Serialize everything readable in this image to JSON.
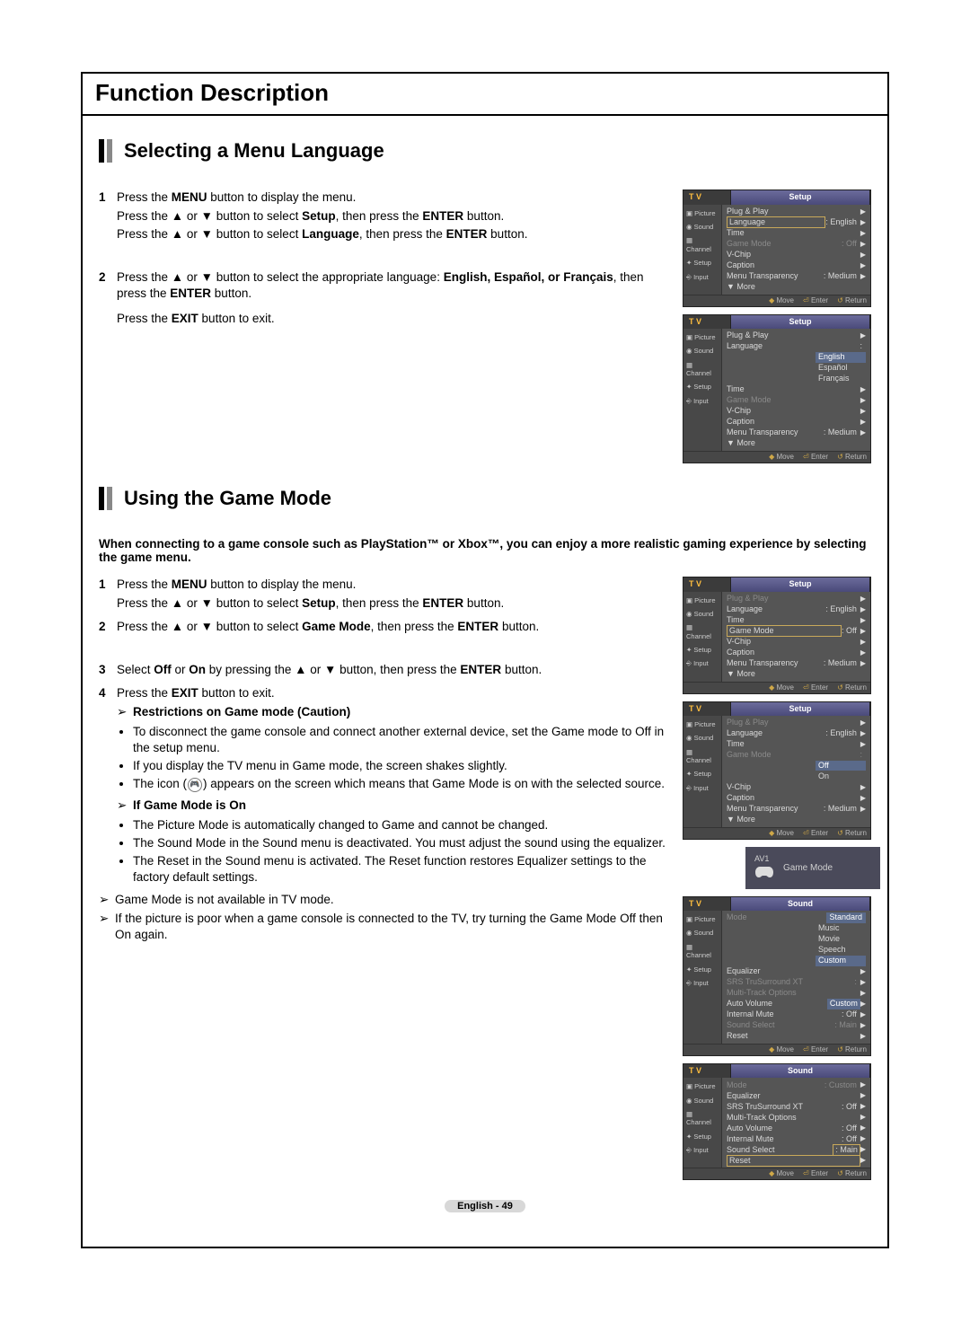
{
  "title": "Function Description",
  "section1": {
    "heading": "Selecting a Menu Language",
    "steps": [
      {
        "num": "1",
        "lines": [
          {
            "pre": "Press the ",
            "b1": "MENU",
            "post": " button to display the menu."
          },
          {
            "pre": "Press the ▲ or ▼ button to select ",
            "b1": "Setup",
            "mid": ", then press the ",
            "b2": "ENTER",
            "post": " button."
          },
          {
            "pre": "Press the ▲ or ▼ button to select ",
            "b1": "Language",
            "mid": ", then press the ",
            "b2": "ENTER",
            "post": " button."
          }
        ]
      },
      {
        "num": "2",
        "lines": [
          {
            "text": "Press the ▲ or ▼ button to select the appropriate language: ",
            "langs": "English, Español, or Français",
            "mid": ", then press the ",
            "b1": "ENTER",
            "post": " button."
          },
          {
            "pre": "Press the ",
            "b1": "EXIT",
            "post": " button to exit."
          }
        ]
      }
    ]
  },
  "section2": {
    "heading": "Using the Game Mode",
    "intro": "When connecting to a game console such as PlayStation™ or Xbox™, you can enjoy a more realistic gaming experience by selecting the game menu.",
    "steps": [
      {
        "num": "1",
        "lines": [
          {
            "pre": "Press the ",
            "b1": "MENU",
            "post": " button to display the menu."
          },
          {
            "pre": "Press the ▲ or ▼ button to select ",
            "b1": "Setup",
            "mid": ", then press the ",
            "b2": "ENTER",
            "post": " button."
          }
        ]
      },
      {
        "num": "2",
        "lines": [
          {
            "pre": "Press the ▲ or ▼ button to select ",
            "b1": "Game Mode",
            "mid": ", then press the ",
            "b2": "ENTER",
            "post": " button."
          }
        ]
      },
      {
        "num": "3",
        "lines": [
          {
            "pre": "Select ",
            "b1": "Off",
            "mid": " or ",
            "b2": "On",
            "mid2": " by pressing the ▲ or ▼ button, then press the ",
            "b3": "ENTER",
            "post": " button."
          }
        ]
      },
      {
        "num": "4",
        "lines": [
          {
            "pre": "Press the ",
            "b1": "EXIT",
            "post": " button to exit."
          }
        ]
      }
    ],
    "restrictions_head": "Restrictions on Game mode (Caution)",
    "restrictions": [
      "To disconnect the game console and connect another external device, set the Game mode to Off in the setup menu.",
      "If you display the TV menu in Game mode, the screen shakes slightly.",
      "The icon ( 🎮 ) appears on the screen which means that Game Mode is on with the selected source."
    ],
    "ifon_head": "If Game Mode is On",
    "ifon": [
      "The Picture Mode is automatically changed to Game and cannot be changed.",
      "The Sound Mode in the Sound menu is deactivated. You must adjust the sound using the equalizer.",
      "The Reset in the Sound menu is activated. The Reset function restores Equalizer settings to the factory default settings."
    ],
    "notes": [
      "Game Mode is not available in TV mode.",
      "If the picture is poor when a game console is connected to the TV, try turning the Game Mode Off then On again."
    ]
  },
  "osd_side": [
    "Picture",
    "Sound",
    "Channel",
    "Setup",
    "Input"
  ],
  "osd1": {
    "tab": "Setup",
    "tv": "T V",
    "rows": [
      {
        "label": "Plug & Play"
      },
      {
        "label": "Language",
        "val": ": English",
        "boxed": true
      },
      {
        "label": "Time"
      },
      {
        "label": "Game Mode",
        "val": ": Off",
        "dim": true
      },
      {
        "label": "V-Chip"
      },
      {
        "label": "Caption"
      },
      {
        "label": "Menu Transparency",
        "val": ": Medium"
      },
      {
        "label": "▼ More",
        "more": true
      }
    ]
  },
  "osd2": {
    "tab": "Setup",
    "tv": "T V",
    "rows": [
      {
        "label": "Plug & Play"
      },
      {
        "label": "Language",
        "opts": [
          "English",
          "Español",
          "Français"
        ]
      },
      {
        "label": "Time"
      },
      {
        "label": "Game Mode",
        "dim": true
      },
      {
        "label": "V-Chip"
      },
      {
        "label": "Caption"
      },
      {
        "label": "Menu Transparency",
        "val": ": Medium"
      },
      {
        "label": "▼ More",
        "more": true
      }
    ]
  },
  "osd3": {
    "tab": "Setup",
    "tv": "T V",
    "rows": [
      {
        "label": "Plug & Play",
        "dim": true
      },
      {
        "label": "Language",
        "val": ": English"
      },
      {
        "label": "Time"
      },
      {
        "label": "Game Mode",
        "val": ": Off",
        "boxed": true
      },
      {
        "label": "V-Chip"
      },
      {
        "label": "Caption"
      },
      {
        "label": "Menu Transparency",
        "val": ": Medium"
      },
      {
        "label": "▼ More",
        "more": true
      }
    ]
  },
  "osd4": {
    "tab": "Setup",
    "tv": "T V",
    "rows": [
      {
        "label": "Plug & Play",
        "dim": true
      },
      {
        "label": "Language",
        "val": ": English"
      },
      {
        "label": "Time"
      },
      {
        "label": "Game Mode",
        "opts": [
          "Off",
          "On"
        ],
        "dim": true
      },
      {
        "label": "V-Chip"
      },
      {
        "label": "Caption"
      },
      {
        "label": "Menu Transparency",
        "val": ": Medium"
      },
      {
        "label": "▼ More",
        "more": true
      }
    ]
  },
  "badge": {
    "av1": "AV1",
    "label": "Game Mode"
  },
  "osd5": {
    "tab": "Sound",
    "tv": "T V",
    "rows": [
      {
        "label": "Mode",
        "val": "Standard",
        "dim": true,
        "optsR": [
          "Standard",
          "Music",
          "Movie",
          "Speech",
          "Custom"
        ]
      },
      {
        "label": "Equalizer"
      },
      {
        "label": "SRS TruSurround XT",
        "val": ":",
        "dim": true
      },
      {
        "label": "Multi-Track Options",
        "dim": true
      },
      {
        "label": "Auto Volume",
        "hl": "Custom"
      },
      {
        "label": "Internal Mute",
        "val": ": Off"
      },
      {
        "label": "Sound Select",
        "val": ": Main",
        "dim": true
      },
      {
        "label": "Reset"
      }
    ]
  },
  "osd6": {
    "tab": "Sound",
    "tv": "T V",
    "rows": [
      {
        "label": "Mode",
        "val": ": Custom",
        "dim": true
      },
      {
        "label": "Equalizer"
      },
      {
        "label": "SRS TruSurround XT",
        "val": ": Off"
      },
      {
        "label": "Multi-Track Options"
      },
      {
        "label": "Auto Volume",
        "val": ": Off"
      },
      {
        "label": "Internal Mute",
        "val": ": Off"
      },
      {
        "label": "Sound Select",
        "val": ": Main",
        "boxedval": true
      },
      {
        "label": "Reset",
        "boxed": true
      }
    ]
  },
  "osd_foot": {
    "move": "Move",
    "enter": "Enter",
    "ret": "Return"
  },
  "page_num": "English - 49"
}
